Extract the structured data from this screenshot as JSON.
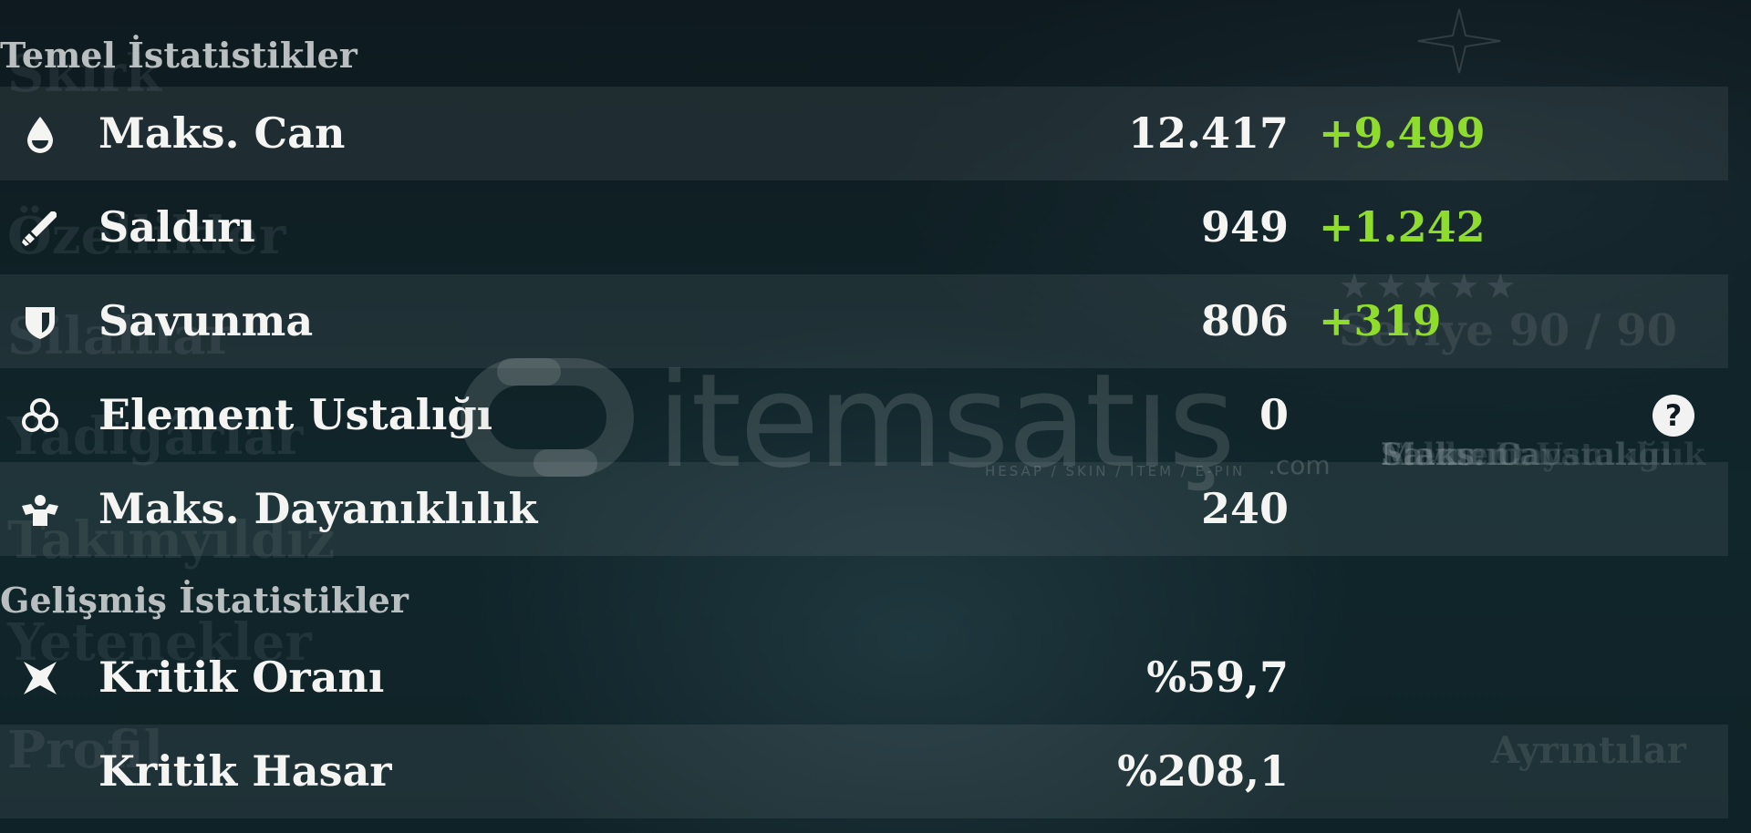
{
  "background": {
    "left_menu": [
      "Skirk",
      "Özellikler",
      "Silahlar",
      "Yadigârlar",
      "Takımyıldız",
      "Yetenekler",
      "Profil"
    ],
    "right_panel": {
      "level": "Seviye 90 / 90",
      "stats": [
        "Maks. Can",
        "Saldırı",
        "Savunma",
        "Element Ustalığı",
        "Maks. Dayanıklılık"
      ],
      "details_button": "Ayrıntılar"
    }
  },
  "watermark": {
    "word": "itemsatış",
    "tagline": "HESAP / SKIN / ITEM / E-PIN",
    "dotcom": ".com"
  },
  "base_stats": {
    "title": "Temel İstatistikler",
    "rows": [
      {
        "label": "Maks. Can",
        "value": "12.417",
        "bonus": "+9.499",
        "icon": "hp-drop-icon"
      },
      {
        "label": "Saldırı",
        "value": "949",
        "bonus": "+1.242",
        "icon": "sword-icon"
      },
      {
        "label": "Savunma",
        "value": "806",
        "bonus": "+319",
        "icon": "shield-icon"
      },
      {
        "label": "Element Ustalığı",
        "value": "0",
        "bonus": "",
        "icon": "elemental-mastery-icon"
      },
      {
        "label": "Maks. Dayanıklılık",
        "value": "240",
        "bonus": "",
        "icon": "stamina-icon"
      }
    ],
    "help": "?"
  },
  "advanced_stats": {
    "title": "Gelişmiş İstatistikler",
    "rows": [
      {
        "label": "Kritik Oranı",
        "value": "%59,7",
        "icon": "crit-rate-icon"
      },
      {
        "label": "Kritik Hasar",
        "value": "%208,1",
        "icon": ""
      }
    ]
  },
  "colors": {
    "bonus": "#8fdc2c",
    "text": "#f4f4f2",
    "section": "#b9bfc1"
  }
}
